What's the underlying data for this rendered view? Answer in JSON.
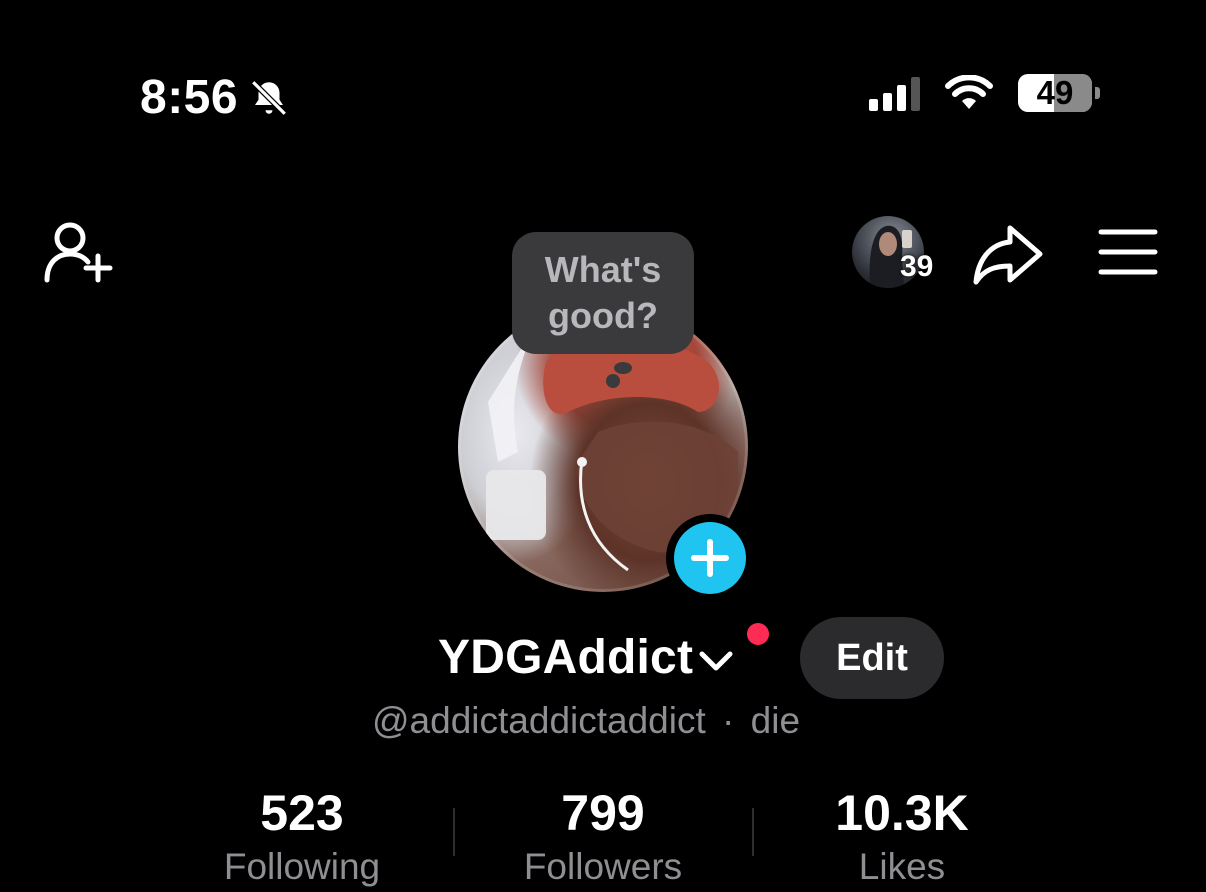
{
  "status_bar": {
    "time": "8:56",
    "battery": "49"
  },
  "header": {
    "visitor_count": "39"
  },
  "bubble": {
    "line1": "What's",
    "line2": "good?"
  },
  "profile": {
    "username": "YDGAddict",
    "handle": "@addictaddictaddict",
    "separator": "·",
    "pronouns": "die",
    "edit_label": "Edit"
  },
  "stats": [
    {
      "value": "523",
      "label": "Following"
    },
    {
      "value": "799",
      "label": "Followers"
    },
    {
      "value": "10.3K",
      "label": "Likes"
    }
  ],
  "colors": {
    "background": "#000000",
    "accent_blue": "#20c4f0",
    "notification_red": "#fe2c55",
    "secondary_text": "#8e8e93"
  },
  "icons": [
    "bell-slash-icon",
    "cellular-signal-icon",
    "wifi-icon",
    "battery-icon",
    "add-friend-icon",
    "share-icon",
    "menu-icon",
    "chevron-down-icon",
    "plus-icon"
  ]
}
